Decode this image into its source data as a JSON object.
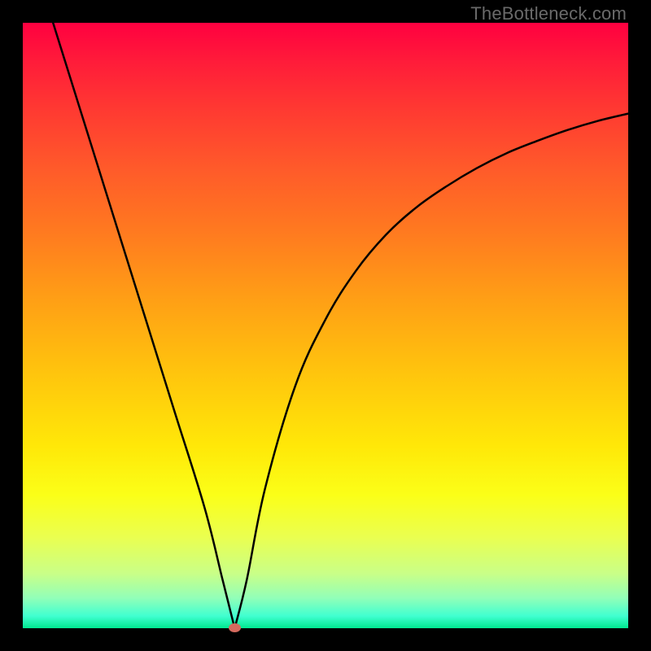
{
  "watermark": "TheBottleneck.com",
  "chart_data": {
    "type": "line",
    "title": "",
    "xlabel": "",
    "ylabel": "",
    "xlim": [
      0,
      100
    ],
    "ylim": [
      0,
      100
    ],
    "background_gradient": {
      "top": "#ff0040",
      "bottom": "#00e890",
      "description": "red-orange-yellow-green vertical gradient"
    },
    "series": [
      {
        "name": "left-branch",
        "x": [
          5,
          10,
          15,
          20,
          25,
          30,
          33,
          35
        ],
        "values": [
          100,
          84,
          68,
          52,
          36,
          20,
          8,
          0
        ]
      },
      {
        "name": "right-branch",
        "x": [
          35,
          37,
          40,
          45,
          50,
          55,
          60,
          65,
          70,
          75,
          80,
          85,
          90,
          95,
          100
        ],
        "values": [
          0,
          8,
          23,
          40,
          51,
          59,
          65,
          69.5,
          73,
          76,
          78.5,
          80.5,
          82.3,
          83.8,
          85
        ]
      }
    ],
    "marker": {
      "x": 35,
      "y": 0,
      "color": "#d46a5e"
    },
    "grid": false,
    "legend": false
  }
}
